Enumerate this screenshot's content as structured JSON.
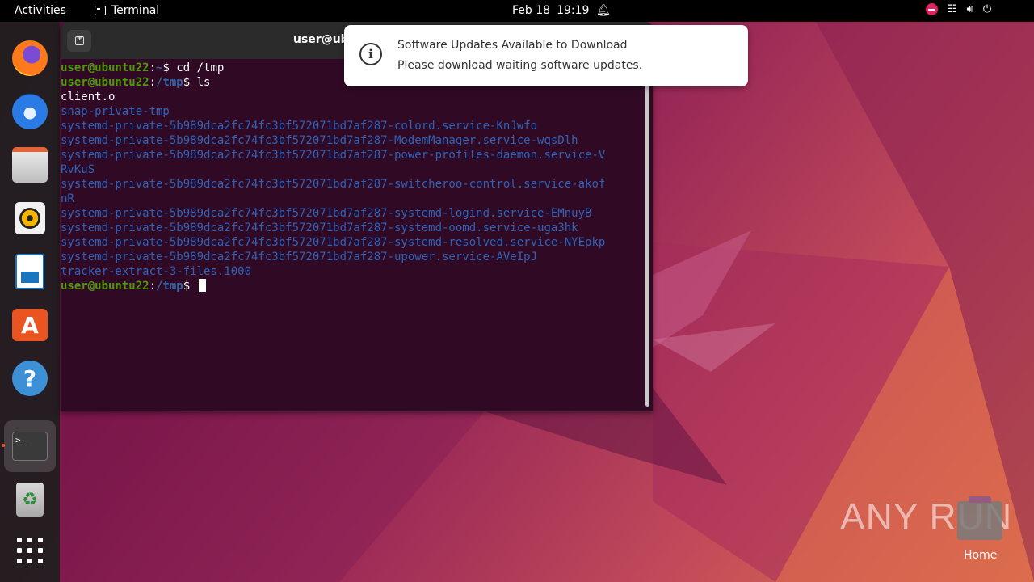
{
  "topbar": {
    "activities": "Activities",
    "app_name": "Terminal",
    "date": "Feb 18",
    "time": "19:19"
  },
  "dock": {
    "items": [
      "firefox-icon",
      "thunderbird-icon",
      "files-icon",
      "rhythmbox-icon",
      "writer-icon",
      "software-icon",
      "help-icon",
      "terminal-icon",
      "trash-icon",
      "app-grid-icon"
    ]
  },
  "terminal": {
    "title": "user@ub",
    "prompt_user": "user@ubuntu22",
    "lines": [
      {
        "type": "prompt",
        "path": "~",
        "cmd": " cd /tmp"
      },
      {
        "type": "prompt",
        "path": "/tmp",
        "cmd": " ls"
      },
      {
        "type": "file",
        "text": "client.o"
      },
      {
        "type": "dir",
        "text": "snap-private-tmp"
      },
      {
        "type": "dir",
        "text": "systemd-private-5b989dca2fc74fc3bf572071bd7af287-colord.service-KnJwfo"
      },
      {
        "type": "dir",
        "text": "systemd-private-5b989dca2fc74fc3bf572071bd7af287-ModemManager.service-wqsDlh"
      },
      {
        "type": "dir",
        "text": "systemd-private-5b989dca2fc74fc3bf572071bd7af287-power-profiles-daemon.service-V"
      },
      {
        "type": "dir",
        "text": "RvKuS"
      },
      {
        "type": "dir",
        "text": "systemd-private-5b989dca2fc74fc3bf572071bd7af287-switcheroo-control.service-akof"
      },
      {
        "type": "dir",
        "text": "nR"
      },
      {
        "type": "dir",
        "text": "systemd-private-5b989dca2fc74fc3bf572071bd7af287-systemd-logind.service-EMnuyB"
      },
      {
        "type": "dir",
        "text": "systemd-private-5b989dca2fc74fc3bf572071bd7af287-systemd-oomd.service-uga3hk"
      },
      {
        "type": "dir",
        "text": "systemd-private-5b989dca2fc74fc3bf572071bd7af287-systemd-resolved.service-NYEpkp"
      },
      {
        "type": "dir",
        "text": "systemd-private-5b989dca2fc74fc3bf572071bd7af287-upower.service-AVeIpJ"
      },
      {
        "type": "dir",
        "text": "tracker-extract-3-files.1000"
      },
      {
        "type": "prompt",
        "path": "/tmp",
        "cmd": " ",
        "cursor": true
      }
    ]
  },
  "notification": {
    "title": "Software Updates Available to Download",
    "body": "Please download waiting software updates."
  },
  "desktop": {
    "watermark": "ANY RUN",
    "home_label": "Home"
  }
}
